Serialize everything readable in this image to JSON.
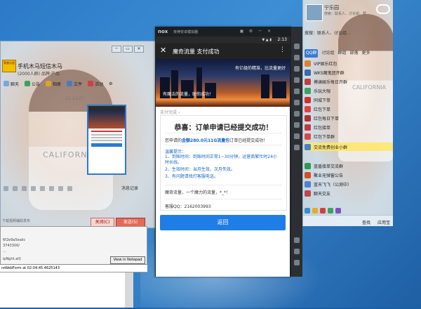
{
  "chat": {
    "name": "手机木马短信木马",
    "subtitle": "(2000人群) 品牌:产品",
    "avatar_text": "荣誉乐团",
    "minimize": "─",
    "restore": "▭",
    "close": "✕",
    "toolbar": [
      "聊天",
      "公告",
      "相册",
      "文件",
      "活动"
    ],
    "time": "21:13:27",
    "history": "消息记录",
    "footer_link": "下载视频辅助发布",
    "close_btn": "关闭(C)",
    "send_btn": "发送(S)"
  },
  "console": {
    "lines": [
      "6f2e9a5eaiic",
      "3743300/",
      "...",
      "ipNght.all)"
    ],
    "view_btn": "View in Notepad",
    "status": "reWebForm at 02:04:45.4625143"
  },
  "nox": {
    "logo": "nox",
    "title": "夜神安卓模拟器",
    "ctrl_icons": [
      "▣",
      "⚙",
      "─",
      "✕"
    ],
    "clock": "2:13",
    "status_icons": "▼ ▲ ▮",
    "app_close": "✕",
    "app_title": "魔奇流量 支付成功",
    "app_menu": "⋮",
    "banner_top": "有亿级的精准，比流量更好",
    "banner_bottom": "有魔法的流量，助你成功！",
    "crumb": "支付完成 ›",
    "success": "恭喜：订单申请已经提交成功！",
    "order_pre": "您申请的",
    "order_hl": "金额280.0元11G流量包",
    "order_post": "订单已经提交成功！",
    "tips_title": "温馨提示：",
    "tips": [
      "1、到账时间：到账时间正常1~30分钟，运营商繁忙时24小时长线。",
      "2、生效时间：当月生效，次月失效。",
      "3、有问题请找打客服电话。"
    ],
    "slogan": "魔奇流量，一个魔力的流量，*_*！",
    "qq": "客服QQ：2162003993",
    "return_btn": "返回"
  },
  "qq": {
    "name": "宁乐园",
    "signature": "搜索：联系人、讨论组、群...",
    "search": "搜搜：联系人、讨论组...",
    "tabs": [
      "QQ群",
      "讨论组",
      "群组",
      "部落",
      "更多"
    ],
    "groups": [
      "VIP娱乐红包",
      "WKS魔鬼团开群",
      "搏澜娱乐每日开群",
      "乐玩大咖",
      "同城下单",
      "红包下单",
      "红包每日下单",
      "红包接单",
      "红包下单群",
      "交流免费创业小群",
      "蓝盾接单交流群",
      "聚业无弹窗公告",
      "蓝天飞飞（公测中）",
      "聊天交友"
    ],
    "find": "查找",
    "apps": "应用宝"
  }
}
